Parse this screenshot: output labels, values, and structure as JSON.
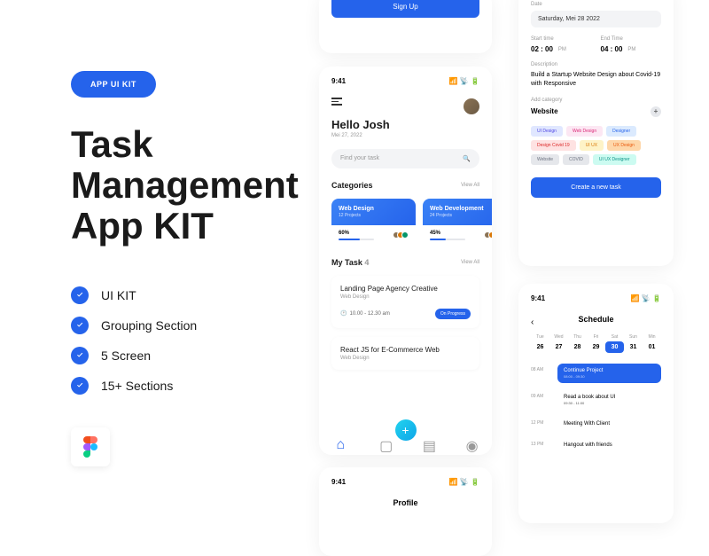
{
  "promo": {
    "badge": "APP UI KIT",
    "title_l1": "Task",
    "title_l2": "Management",
    "title_l3": "App KIT",
    "features": [
      "UI KIT",
      "Grouping Section",
      "5 Screen",
      "15+ Sections"
    ]
  },
  "signup": {
    "button": "Sign Up"
  },
  "home": {
    "time": "9:41",
    "greeting": "Hello Josh",
    "date": "Mei 27, 2022",
    "search_placeholder": "Find your task",
    "categories_title": "Categories",
    "view_all": "View All",
    "cards": [
      {
        "title": "Web Design",
        "projects": "12 Projects",
        "pct": "60%",
        "pctw": 60
      },
      {
        "title": "Web Development",
        "projects": "24 Projects",
        "pct": "45%",
        "pctw": 45
      }
    ],
    "mytask_title": "My Task",
    "mytask_count": "4",
    "tasks": [
      {
        "title": "Landing Page Agency Creative",
        "cat": "Web Design",
        "time": "10.00 - 12.30 am",
        "status": "On Progress"
      },
      {
        "title": "React JS for E-Commerce Web",
        "cat": "Web Design"
      }
    ]
  },
  "newtask": {
    "date_label": "Date",
    "date": "Saturday, Mei 28 2022",
    "start_label": "Start time",
    "start": "02 : 00",
    "start_ampm": "PM",
    "end_label": "End Time",
    "end": "04 : 00",
    "end_ampm": "PM",
    "desc_label": "Description",
    "desc": "Build a Startup Website Design about Covid-19 with Responsive",
    "addcat_label": "Add category",
    "addcat_value": "Website",
    "tags": [
      {
        "t": "UI Design",
        "bg": "#e0e7ff",
        "c": "#4f46e5"
      },
      {
        "t": "Web Design",
        "bg": "#fce7f3",
        "c": "#db2777"
      },
      {
        "t": "Designer",
        "bg": "#dbeafe",
        "c": "#2563eb"
      },
      {
        "t": "Design Covid 19",
        "bg": "#fee2e2",
        "c": "#dc2626"
      },
      {
        "t": "UI UX",
        "bg": "#fef3c7",
        "c": "#d97706"
      },
      {
        "t": "UX Design",
        "bg": "#fed7aa",
        "c": "#ea580c"
      },
      {
        "t": "Website",
        "bg": "#e5e7eb",
        "c": "#6b7280"
      },
      {
        "t": "COVID",
        "bg": "#e5e7eb",
        "c": "#6b7280"
      },
      {
        "t": "UI UX Designer",
        "bg": "#ccfbf1",
        "c": "#0d9488"
      }
    ],
    "create": "Create a new task"
  },
  "schedule": {
    "time": "9:41",
    "title": "Schedule",
    "days": [
      {
        "n": "Tue",
        "d": "26"
      },
      {
        "n": "Wed",
        "d": "27"
      },
      {
        "n": "Thu",
        "d": "28"
      },
      {
        "n": "Fri",
        "d": "29"
      },
      {
        "n": "Sat",
        "d": "30",
        "active": true
      },
      {
        "n": "Sun",
        "d": "31"
      },
      {
        "n": "Min",
        "d": "01"
      }
    ],
    "items": [
      {
        "tm": "08 AM",
        "t": "Continue Project",
        "s": "08:00 - 09:30",
        "blue": true
      },
      {
        "tm": "09 AM",
        "t": "Read a book about UI",
        "s": "09:30 - 11:00"
      },
      {
        "tm": "12 PM",
        "t": "Meeting With Client",
        "s": ""
      },
      {
        "tm": "13 PM",
        "t": "Hangout with friends",
        "s": ""
      }
    ]
  },
  "profile": {
    "time": "9:41",
    "title": "Profile"
  }
}
